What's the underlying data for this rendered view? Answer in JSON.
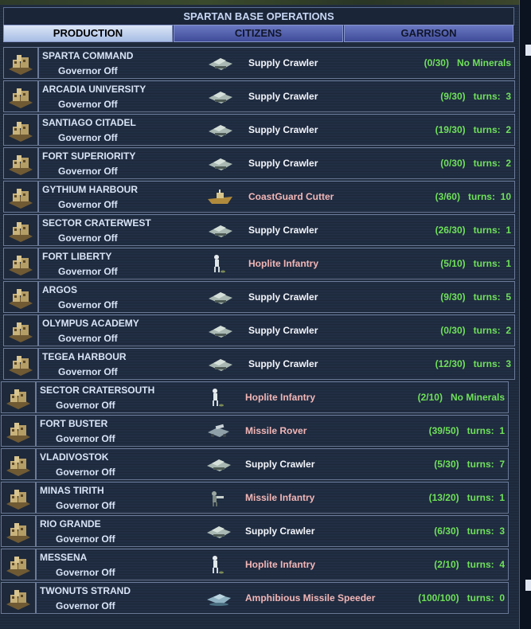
{
  "panel": {
    "title": "SPARTAN BASE OPERATIONS",
    "tabs": [
      {
        "label": "PRODUCTION",
        "active": true
      },
      {
        "label": "CITIZENS",
        "active": false
      },
      {
        "label": "GARRISON",
        "active": false
      }
    ]
  },
  "colors": {
    "status_green": "#6fe05a",
    "unit_white": "#f4f6fb",
    "unit_pink": "#f2b6b6"
  },
  "bases": [
    {
      "name": "SPARTA COMMAND",
      "governor": "Governor Off",
      "unit": "Supply Crawler",
      "unit_icon": "supply-crawler-icon",
      "unit_color": "white",
      "progress": "(0/30)",
      "eta": "No Minerals"
    },
    {
      "name": "ARCADIA UNIVERSITY",
      "governor": "Governor Off",
      "unit": "Supply Crawler",
      "unit_icon": "supply-crawler-icon",
      "unit_color": "white",
      "progress": "(9/30)",
      "eta": "turns:  3"
    },
    {
      "name": "SANTIAGO CITADEL",
      "governor": "Governor Off",
      "unit": "Supply Crawler",
      "unit_icon": "supply-crawler-icon",
      "unit_color": "white",
      "progress": "(19/30)",
      "eta": "turns:  2"
    },
    {
      "name": "FORT SUPERIORITY",
      "governor": "Governor Off",
      "unit": "Supply Crawler",
      "unit_icon": "supply-crawler-icon",
      "unit_color": "white",
      "progress": "(0/30)",
      "eta": "turns:  2"
    },
    {
      "name": "GYTHIUM HARBOUR",
      "governor": "Governor Off",
      "unit": "CoastGuard Cutter",
      "unit_icon": "coastguard-cutter-icon",
      "unit_color": "pink",
      "progress": "(3/60)",
      "eta": "turns:  10"
    },
    {
      "name": "SECTOR CRATERWEST",
      "governor": "Governor Off",
      "unit": "Supply Crawler",
      "unit_icon": "supply-crawler-icon",
      "unit_color": "white",
      "progress": "(26/30)",
      "eta": "turns:  1"
    },
    {
      "name": "FORT LIBERTY",
      "governor": "Governor Off",
      "unit": "Hoplite Infantry",
      "unit_icon": "hoplite-infantry-icon",
      "unit_color": "pink",
      "progress": "(5/10)",
      "eta": "turns:  1"
    },
    {
      "name": "ARGOS",
      "governor": "Governor Off",
      "unit": "Supply Crawler",
      "unit_icon": "supply-crawler-icon",
      "unit_color": "white",
      "progress": "(9/30)",
      "eta": "turns:  5"
    },
    {
      "name": "OLYMPUS ACADEMY",
      "governor": "Governor Off",
      "unit": "Supply Crawler",
      "unit_icon": "supply-crawler-icon",
      "unit_color": "white",
      "progress": "(0/30)",
      "eta": "turns:  2"
    },
    {
      "name": "TEGEA HARBOUR",
      "governor": "Governor Off",
      "unit": "Supply Crawler",
      "unit_icon": "supply-crawler-icon",
      "unit_color": "white",
      "progress": "(12/30)",
      "eta": "turns:  3"
    },
    {
      "name": "SECTOR CRATERSOUTH",
      "governor": "Governor Off",
      "unit": "Hoplite Infantry",
      "unit_icon": "hoplite-infantry-icon",
      "unit_color": "pink",
      "progress": "(2/10)",
      "eta": "No Minerals"
    },
    {
      "name": "FORT BUSTER",
      "governor": "Governor Off",
      "unit": "Missile Rover",
      "unit_icon": "missile-rover-icon",
      "unit_color": "pink",
      "progress": "(39/50)",
      "eta": "turns:  1"
    },
    {
      "name": "VLADIVOSTOK",
      "governor": "Governor Off",
      "unit": "Supply Crawler",
      "unit_icon": "supply-crawler-icon",
      "unit_color": "white",
      "progress": "(5/30)",
      "eta": "turns:  7"
    },
    {
      "name": "MINAS TIRITH",
      "governor": "Governor Off",
      "unit": "Missile Infantry",
      "unit_icon": "missile-infantry-icon",
      "unit_color": "pink",
      "progress": "(13/20)",
      "eta": "turns:  1"
    },
    {
      "name": "RIO GRANDE",
      "governor": "Governor Off",
      "unit": "Supply Crawler",
      "unit_icon": "supply-crawler-icon",
      "unit_color": "white",
      "progress": "(6/30)",
      "eta": "turns:  3"
    },
    {
      "name": "MESSENA",
      "governor": "Governor Off",
      "unit": "Hoplite Infantry",
      "unit_icon": "hoplite-infantry-icon",
      "unit_color": "pink",
      "progress": "(2/10)",
      "eta": "turns:  4"
    },
    {
      "name": "TWONUTS STRAND",
      "governor": "Governor Off",
      "unit": "Amphibious Missile Speeder",
      "unit_icon": "amphibious-missile-speeder-icon",
      "unit_color": "pink",
      "progress": "(100/100)",
      "eta": "turns:  0"
    }
  ]
}
